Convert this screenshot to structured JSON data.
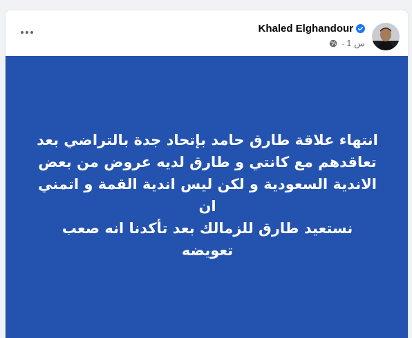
{
  "post": {
    "author_name": "Khaled Elghandour",
    "time": "1 س",
    "separator": "·",
    "privacy_icon": "globe-icon",
    "verified_icon": "verified-badge-icon",
    "more_icon": "more-options-icon",
    "background_color": "#2353ae",
    "text_lines": [
      "انتهاء علاقة طارق حامد بإتحاد جدة بالتراضي بعد",
      "تعاقدهم مع كانتي و طارق لديه عروض من بعض",
      "الاندية السعودية و لكن ليس اندية القمة و اتمني ان",
      "نستعيد طارق للزمالك بعد تأكدنا انه صعب تعويضه"
    ]
  }
}
